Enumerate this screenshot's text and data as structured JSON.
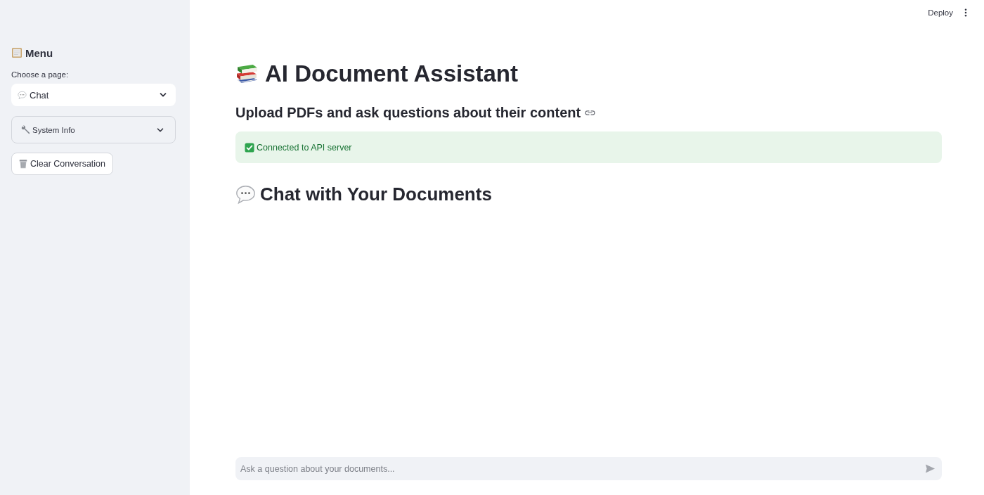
{
  "sidebar": {
    "title": "Menu",
    "select_label": "Choose a page:",
    "select": {
      "value": "Chat"
    },
    "expander": {
      "label": "System Info",
      "expanded": false
    },
    "buttons": [
      {
        "label": "Clear Conversation"
      }
    ]
  },
  "header": {
    "deploy": "Deploy"
  },
  "main": {
    "title": "AI Document Assistant",
    "subtitle": "Upload PDFs and ask questions about their content",
    "alert": {
      "kind": "success",
      "text": "Connected to API server"
    },
    "section_title": "Chat with Your Documents"
  },
  "chat_input": {
    "placeholder": "Ask a question about your documents..."
  }
}
